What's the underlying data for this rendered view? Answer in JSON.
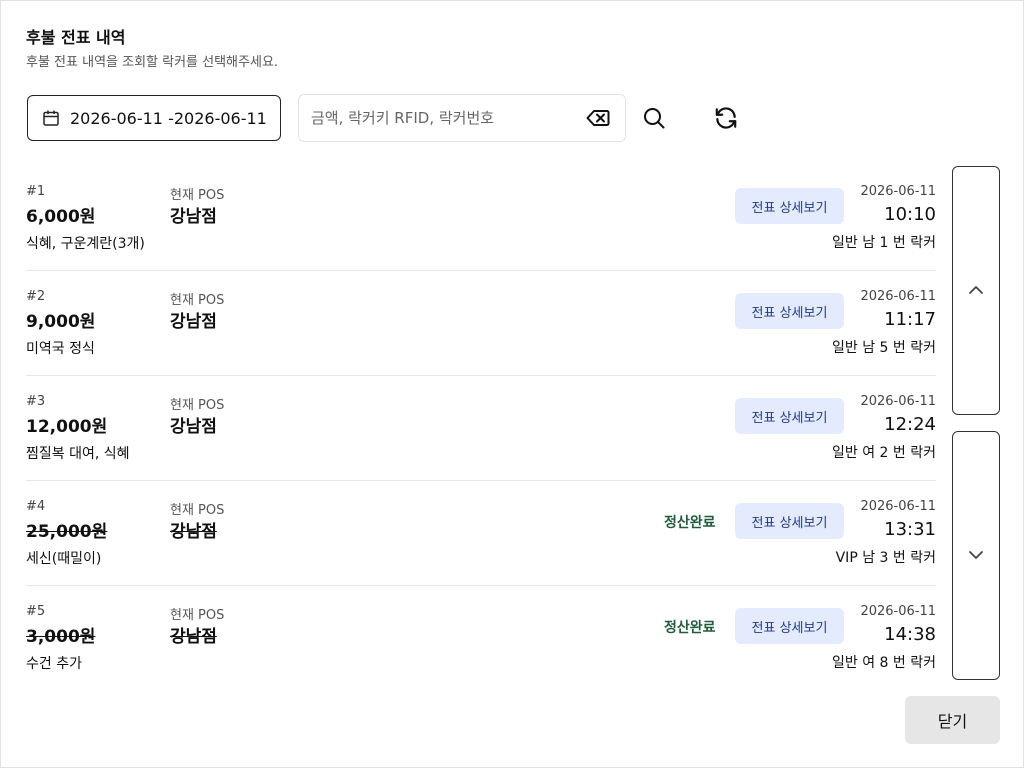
{
  "header": {
    "title": "후불 전표 내역",
    "subtitle": "후불 전표 내역을 조회할 락커를 선택해주세요."
  },
  "filters": {
    "date_range": "2026-06-11 -2026-06-11",
    "search_placeholder": "금액, 락커키 RFID, 락커번호",
    "search_value": ""
  },
  "icons": {
    "calendar": "calendar-icon",
    "clear": "backspace-clear-icon",
    "search": "search-icon",
    "refresh": "refresh-icon",
    "up": "chevron-up-icon",
    "down": "chevron-down-icon"
  },
  "colors": {
    "detail_button_bg": "#e4ebff",
    "detail_button_text": "#213a8a",
    "settled_text": "#1f5c3a",
    "close_button_bg": "#e6e6e6"
  },
  "rows": [
    {
      "num": "#1",
      "amount": "6,000원",
      "items": "식혜, 구운계란(3개)",
      "pos_label": "현재 POS",
      "store": "강남점",
      "settled": "",
      "detail_label": "전표 상세보기",
      "date": "2026-06-11",
      "time": "10:10",
      "locker": "일반 남 1 번 락커",
      "is_settled": false
    },
    {
      "num": "#2",
      "amount": "9,000원",
      "items": "미역국 정식",
      "pos_label": "현재 POS",
      "store": "강남점",
      "settled": "",
      "detail_label": "전표 상세보기",
      "date": "2026-06-11",
      "time": "11:17",
      "locker": "일반 남 5 번 락커",
      "is_settled": false
    },
    {
      "num": "#3",
      "amount": "12,000원",
      "items": "찜질복 대여, 식혜",
      "pos_label": "현재 POS",
      "store": "강남점",
      "settled": "",
      "detail_label": "전표 상세보기",
      "date": "2026-06-11",
      "time": "12:24",
      "locker": "일반 여 2 번 락커",
      "is_settled": false
    },
    {
      "num": "#4",
      "amount": "25,000원",
      "items": "세신(때밀이)",
      "pos_label": "현재 POS",
      "store": "강남점",
      "settled": "정산완료",
      "detail_label": "전표 상세보기",
      "date": "2026-06-11",
      "time": "13:31",
      "locker": "VIP 남 3 번 락커",
      "is_settled": true
    },
    {
      "num": "#5",
      "amount": "3,000원",
      "items": "수건 추가",
      "pos_label": "현재 POS",
      "store": "강남점",
      "settled": "정산완료",
      "detail_label": "전표 상세보기",
      "date": "2026-06-11",
      "time": "14:38",
      "locker": "일반 여 8 번 락커",
      "is_settled": true
    }
  ],
  "footer": {
    "close_label": "닫기"
  }
}
